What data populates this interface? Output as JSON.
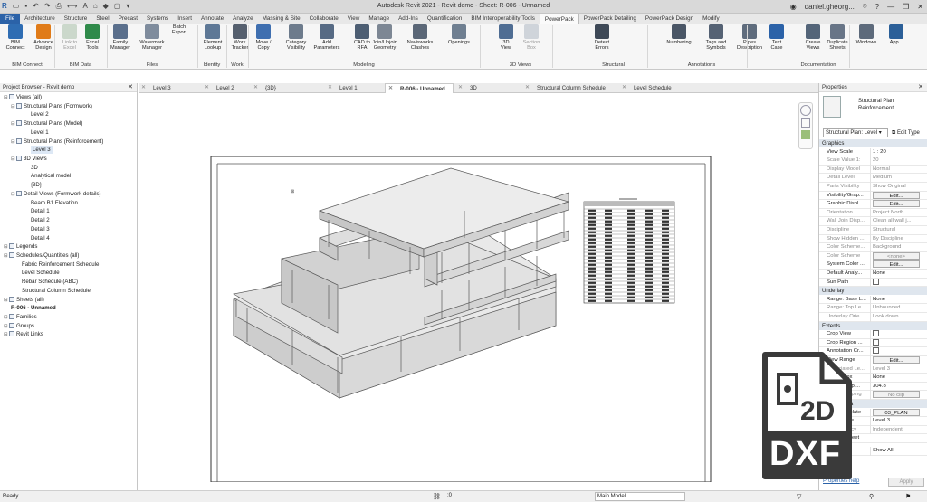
{
  "window": {
    "title": "Autodesk Revit 2021 - Revit demo - Sheet: R-006 - Unnamed",
    "user": "daniel.gheorg..."
  },
  "ribbon_tabs": [
    "File",
    "Architecture",
    "Structure",
    "Steel",
    "Precast",
    "Systems",
    "Insert",
    "Annotate",
    "Analyze",
    "Massing & Site",
    "Collaborate",
    "View",
    "Manage",
    "Add-Ins",
    "Quantification",
    "BIM Interoperability Tools",
    "PowerPack",
    "PowerPack Detailing",
    "PowerPack Design",
    "Modify"
  ],
  "ribbon": {
    "buttons": [
      {
        "label1": "BIM",
        "label2": "Connect",
        "icon": "bim-connect-icon",
        "color": "#2f6db3",
        "disabled": false
      },
      {
        "label1": "Advance",
        "label2": "Design",
        "icon": "advance-design-icon",
        "color": "#e07b18",
        "disabled": false
      },
      {
        "label1": "Link to",
        "label2": "Excel",
        "icon": "excel-link-icon",
        "color": "#7aa07a",
        "disabled": true
      },
      {
        "label1": "Excel",
        "label2": "Tools",
        "icon": "excel-tools-icon",
        "color": "#2f8a4a",
        "disabled": false
      },
      {
        "label1": "Family",
        "label2": "Manager",
        "icon": "family-manager-icon",
        "color": "#5a6f8c",
        "disabled": false
      },
      {
        "label1": "Watermark",
        "label2": "Manager",
        "icon": "watermark-icon",
        "color": "#7f8c9d",
        "disabled": false
      },
      {
        "label1": "Element",
        "label2": "Lookup",
        "icon": "element-lookup-icon",
        "color": "#5e7896",
        "disabled": false
      },
      {
        "label1": "Work",
        "label2": "Tracker",
        "icon": "work-tracker-icon",
        "color": "#555f6e",
        "disabled": false
      },
      {
        "label1": "Move /",
        "label2": "Copy",
        "icon": "move-copy-icon",
        "color": "#3f6fb0",
        "disabled": false
      },
      {
        "label1": "Category",
        "label2": "Visibility",
        "icon": "category-visibility-icon",
        "color": "#6d7b8c",
        "disabled": false
      },
      {
        "label1": "Add",
        "label2": "Parameters",
        "icon": "add-parameters-icon",
        "color": "#566a84",
        "disabled": false
      },
      {
        "label1": "CAD to",
        "label2": "RFA",
        "icon": "cad-to-rfa-icon",
        "color": "#4d5e73",
        "disabled": false
      },
      {
        "label1": "Join/Unjoin",
        "label2": "Geometry",
        "icon": "join-geometry-icon",
        "color": "#7d8794",
        "disabled": false
      },
      {
        "label1": "Navisworks",
        "label2": "Clashes",
        "icon": "navisworks-icon",
        "color": "#5b6777",
        "disabled": false
      },
      {
        "label1": "Openings",
        "label2": "",
        "icon": "openings-icon",
        "color": "#6f7f91",
        "disabled": false
      },
      {
        "label1": "3D",
        "label2": "View",
        "icon": "3d-view-icon",
        "color": "#4f6d93",
        "disabled": false
      },
      {
        "label1": "Section",
        "label2": "Box",
        "icon": "section-box-icon",
        "color": "#8795a5",
        "disabled": true
      },
      {
        "label1": "Detect",
        "label2": "Errors",
        "icon": "detect-errors-icon",
        "color": "#3e4957",
        "disabled": false
      },
      {
        "label1": "Numbering",
        "label2": "",
        "icon": "numbering-icon",
        "color": "#4a5666",
        "disabled": false
      },
      {
        "label1": "Tags and",
        "label2": "Symbols",
        "icon": "tags-symbols-icon",
        "color": "#556274",
        "disabled": false
      },
      {
        "label1": "Pipes",
        "label2": "Description",
        "icon": "pipes-description-icon",
        "color": "#5f6c7d",
        "disabled": false
      },
      {
        "label1": "Text",
        "label2": "Case",
        "icon": "text-case-icon",
        "color": "#2b62a8",
        "disabled": false
      },
      {
        "label1": "Create",
        "label2": "Views",
        "icon": "create-views-icon",
        "color": "#546579",
        "disabled": false
      },
      {
        "label1": "Duplicate",
        "label2": "Sheets",
        "icon": "duplicate-sheets-icon",
        "color": "#687587",
        "disabled": false
      },
      {
        "label1": "Windows",
        "label2": "",
        "icon": "windows-icon",
        "color": "#5d6a7b",
        "disabled": false
      },
      {
        "label1": "App...",
        "label2": "",
        "icon": "app-icon",
        "color": "#2b5f98",
        "disabled": false
      }
    ],
    "batch_export": {
      "label1": "Batch",
      "label2": "Export"
    },
    "panels": [
      "BIM Connect",
      "BIM Data",
      "Files",
      "Identity",
      "Work",
      "Modeling",
      "3D Views",
      "Structural",
      "Annotations",
      "Documentation"
    ]
  },
  "project_browser": {
    "title": "Project Browser - Revit demo",
    "items": [
      {
        "label": "Views (all)",
        "kind": "group"
      },
      {
        "label": "Structural Plans (Formwork)",
        "kind": "group"
      },
      {
        "label": "Level 2",
        "kind": "leaf"
      },
      {
        "label": "Structural Plans (Model)",
        "kind": "group"
      },
      {
        "label": "Level 1",
        "kind": "leaf"
      },
      {
        "label": "Structural Plans (Reinforcement)",
        "kind": "group"
      },
      {
        "label": "Level 3",
        "kind": "selected"
      },
      {
        "label": "3D Views",
        "kind": "group"
      },
      {
        "label": "3D",
        "kind": "leaf"
      },
      {
        "label": "Analytical model",
        "kind": "leaf"
      },
      {
        "label": "{3D}",
        "kind": "leaf"
      },
      {
        "label": "Detail Views (Formwork details)",
        "kind": "group"
      },
      {
        "label": "Beam B1 Elevation",
        "kind": "leaf"
      },
      {
        "label": "Detail 1",
        "kind": "leaf"
      },
      {
        "label": "Detail 2",
        "kind": "leaf"
      },
      {
        "label": "Detail 3",
        "kind": "leaf"
      },
      {
        "label": "Detail 4",
        "kind": "leaf"
      },
      {
        "label": "Legends",
        "kind": "group"
      },
      {
        "label": "Schedules/Quantities (all)",
        "kind": "group"
      },
      {
        "label": "Fabric Reinforcement Schedule",
        "kind": "leaf"
      },
      {
        "label": "Level Schedule",
        "kind": "leaf"
      },
      {
        "label": "Rebar Schedule (ABC)",
        "kind": "leaf"
      },
      {
        "label": "Structural Column Schedule",
        "kind": "leaf"
      },
      {
        "label": "Sheets (all)",
        "kind": "group"
      },
      {
        "label": "R-006 - Unnamed",
        "kind": "bold"
      },
      {
        "label": "Families",
        "kind": "group"
      },
      {
        "label": "Groups",
        "kind": "group"
      },
      {
        "label": "Revit Links",
        "kind": "group"
      }
    ]
  },
  "view_tabs": [
    "Level 3",
    "Level 2",
    "{3D}",
    "Level 1",
    "R-006 - Unnamed",
    "3D",
    "Structural Column Schedule",
    "Level Schedule"
  ],
  "properties": {
    "title": "Properties",
    "type_name1": "Structural Plan",
    "type_name2": "Reinforcement",
    "selector": "Structural Plan: Level",
    "edit_type": "Edit Type",
    "groups": {
      "graphics": "Graphics",
      "underlay": "Underlay",
      "extents": "Extents",
      "identity": "Identity Data"
    },
    "rows_graphics": [
      {
        "k": "View Scale",
        "v": "1 : 20",
        "dim": false,
        "kind": "text"
      },
      {
        "k": "Scale Value    1:",
        "v": "20",
        "dim": true,
        "kind": "text"
      },
      {
        "k": "Display Model",
        "v": "Normal",
        "dim": true,
        "kind": "text"
      },
      {
        "k": "Detail Level",
        "v": "Medium",
        "dim": true,
        "kind": "text"
      },
      {
        "k": "Parts Visibility",
        "v": "Show Original",
        "dim": true,
        "kind": "text"
      },
      {
        "k": "Visibility/Grap...",
        "v": "Edit...",
        "dim": false,
        "kind": "button"
      },
      {
        "k": "Graphic Displ...",
        "v": "Edit...",
        "dim": false,
        "kind": "button"
      },
      {
        "k": "Orientation",
        "v": "Project North",
        "dim": true,
        "kind": "text"
      },
      {
        "k": "Wall Join Disp...",
        "v": "Clean all wall j...",
        "dim": true,
        "kind": "text"
      },
      {
        "k": "Discipline",
        "v": "Structural",
        "dim": true,
        "kind": "text"
      },
      {
        "k": "Show Hidden ...",
        "v": "By Discipline",
        "dim": true,
        "kind": "text"
      },
      {
        "k": "Color Scheme...",
        "v": "Background",
        "dim": true,
        "kind": "text"
      },
      {
        "k": "Color Scheme",
        "v": "<none>",
        "dim": true,
        "kind": "button"
      },
      {
        "k": "System Color ...",
        "v": "Edit...",
        "dim": false,
        "kind": "button"
      },
      {
        "k": "Default Analy...",
        "v": "None",
        "dim": false,
        "kind": "text"
      },
      {
        "k": "Sun Path",
        "v": "",
        "dim": false,
        "kind": "check"
      }
    ],
    "rows_underlay": [
      {
        "k": "Range: Base L...",
        "v": "None",
        "dim": false,
        "kind": "text"
      },
      {
        "k": "Range: Top Le...",
        "v": "Unbounded",
        "dim": true,
        "kind": "text"
      },
      {
        "k": "Underlay Orie...",
        "v": "Look down",
        "dim": true,
        "kind": "text"
      }
    ],
    "rows_extents": [
      {
        "k": "Crop View",
        "v": "",
        "dim": false,
        "kind": "check"
      },
      {
        "k": "Crop Region ...",
        "v": "",
        "dim": false,
        "kind": "check"
      },
      {
        "k": "Annotation Cr...",
        "v": "",
        "dim": false,
        "kind": "check"
      },
      {
        "k": "View Range",
        "v": "Edit...",
        "dim": false,
        "kind": "button"
      },
      {
        "k": "Associated Le...",
        "v": "Level 3",
        "dim": true,
        "kind": "text"
      },
      {
        "k": "Scope Box",
        "v": "None",
        "dim": false,
        "kind": "text"
      },
      {
        "k": "Depth Clippi...",
        "v": "304.8",
        "dim": false,
        "kind": "text"
      },
      {
        "k": "Depth Clipping",
        "v": "No clip",
        "dim": true,
        "kind": "button"
      }
    ],
    "rows_identity": [
      {
        "k": "View Template",
        "v": "03_PLAN",
        "dim": false,
        "kind": "button"
      },
      {
        "k": "View Name",
        "v": "Level 3",
        "dim": false,
        "kind": "text"
      },
      {
        "k": "Dependency",
        "v": "Independent",
        "dim": true,
        "kind": "text"
      },
      {
        "k": "Title on Sheet",
        "v": "",
        "dim": false,
        "kind": "text"
      }
    ],
    "show_all": "Show All",
    "help": "Properties help",
    "apply": "Apply"
  },
  "badge": {
    "top": "2D",
    "bottom": "DXF"
  },
  "status": {
    "left": "Ready",
    "model": "Main Model",
    "scale": ":0"
  }
}
